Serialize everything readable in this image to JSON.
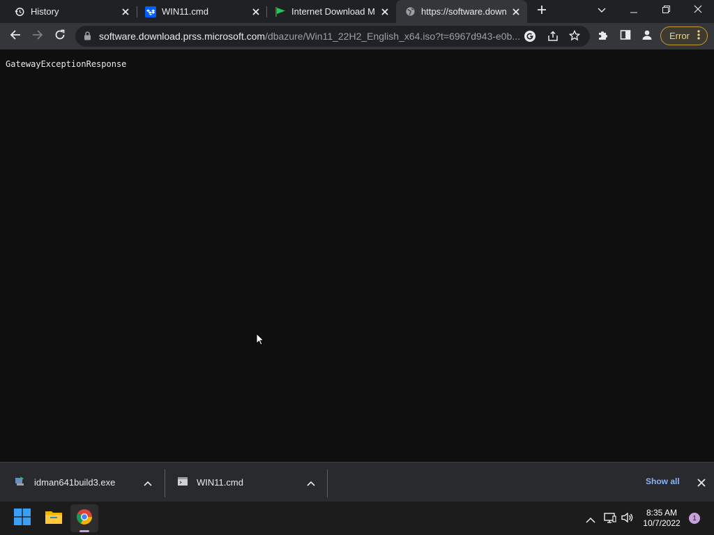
{
  "tabs": [
    {
      "label": "History",
      "icon": "history-icon"
    },
    {
      "label": "WIN11.cmd",
      "icon": "dropbox-icon"
    },
    {
      "label": "Internet Download Ma",
      "icon": "idm-flag-icon"
    },
    {
      "label": "https://software.downl",
      "icon": "globe-icon"
    }
  ],
  "toolbar": {
    "url_host": "software.download.prss.microsoft.com",
    "url_path": "/dbazure/Win11_22H2_English_x64.iso?t=6967d943-e0b...",
    "error_label": "Error"
  },
  "page": {
    "text": "GatewayExceptionResponse"
  },
  "downloads": {
    "items": [
      {
        "name": "idman641build3.exe"
      },
      {
        "name": "WIN11.cmd"
      }
    ],
    "show_all": "Show all"
  },
  "taskbar": {
    "time": "8:35 AM",
    "date": "10/7/2022",
    "notifications": "1"
  },
  "colors": {
    "accent_error": "#f2d485",
    "link": "#8ab4f8",
    "background": "#0f0f0f"
  }
}
